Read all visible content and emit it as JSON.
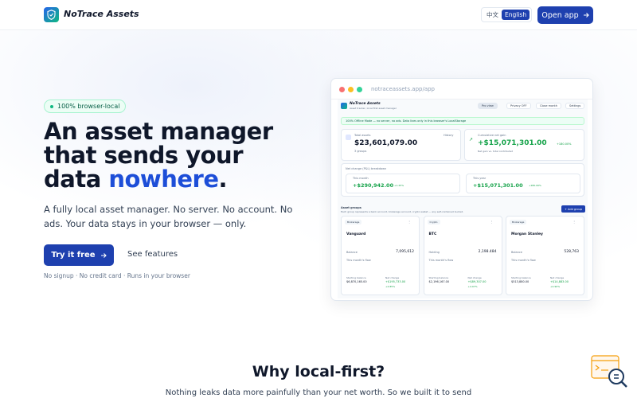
{
  "header": {
    "brand": "NoTrace Assets",
    "lang_options": [
      "中文",
      "English"
    ],
    "lang_active": "English",
    "open_app_label": "Open app"
  },
  "hero": {
    "badge": "100% browser-local",
    "headline_line1": "An asset manager",
    "headline_line2": "that sends your",
    "headline_line3_prefix": "data ",
    "headline_highlight": "nowhere",
    "headline_suffix": ".",
    "subtext": "A fully local asset manager. No server. No account. No ads. Your data stays in your browser — only.",
    "primary_cta": "Try it free",
    "secondary_cta": "See features",
    "fineprint": "No signup · No credit card · Runs in your browser"
  },
  "preview": {
    "url": "notraceassets.app/app",
    "brand": "NoTrace Assets",
    "tagline": "Asset tracker, local-first asset manager",
    "toolbar": [
      "Pro view",
      "Privacy OFF",
      "Close month",
      "Settings"
    ],
    "banner": "100% Offline Mode — no server, no ads. Data lives only in this browser's LocalStorage",
    "total_assets_label": "Total assets",
    "total_assets_value": "$23,601,079.00",
    "total_assets_sub": "3 groups",
    "history_label": "History",
    "cumulative_label": "Cumulative net gain",
    "cumulative_value": "+$15,071,301.00",
    "cumulative_pct": "+180.00%",
    "cumulative_sub": "Net gain vs. total contributed",
    "net_change_label": "Net change (P&L) breakdown",
    "this_month_label": "This month",
    "this_month_value": "+$290,942.00",
    "this_month_pct": "+1.25%",
    "this_year_label": "This year",
    "this_year_value": "+$15,071,301.00",
    "this_year_pct": "+180.00%",
    "asset_groups_label": "Asset groups",
    "asset_groups_sub": "Each group represents a bank account, brokerage account, crypto wallet — any self-contained bucket.",
    "add_group_label": "+ Add group",
    "groups": [
      {
        "tag": "Brokerage",
        "name": "Vanguard",
        "balance_label": "Balance",
        "balance": "7,095,612",
        "flow_label": "This month's flow",
        "starting_label": "Starting balance",
        "starting": "$6,870,165.00",
        "net_label": "Net change",
        "net": "+$195,733.00",
        "net_pct": "+2.85%"
      },
      {
        "tag": "Crypto",
        "name": "BTC",
        "balance_label": "Holding",
        "balance": "2,198.484",
        "flow_label": "This month's flow",
        "starting_label": "Starting balance",
        "starting": "$2,196,167.00",
        "net_label": "Net change",
        "net": "+$89,307.00",
        "net_pct": "+4.07%"
      },
      {
        "tag": "Brokerage",
        "name": "Morgan Stanley",
        "balance_label": "Balance",
        "balance": "528,763",
        "flow_label": "This month's flow",
        "starting_label": "Starting balance",
        "starting": "$513,880.00",
        "net_label": "Net change",
        "net": "+$14,883.00",
        "net_pct": "+2.90%"
      }
    ]
  },
  "why": {
    "title": "Why local-first?",
    "subtitle": "Nothing leaks data more painfully than your net worth. So we built it to send"
  },
  "colors": {
    "brand": "#1e40af",
    "accent": "#1d4ed8",
    "positive": "#16a34a",
    "badge": "#10b981"
  }
}
